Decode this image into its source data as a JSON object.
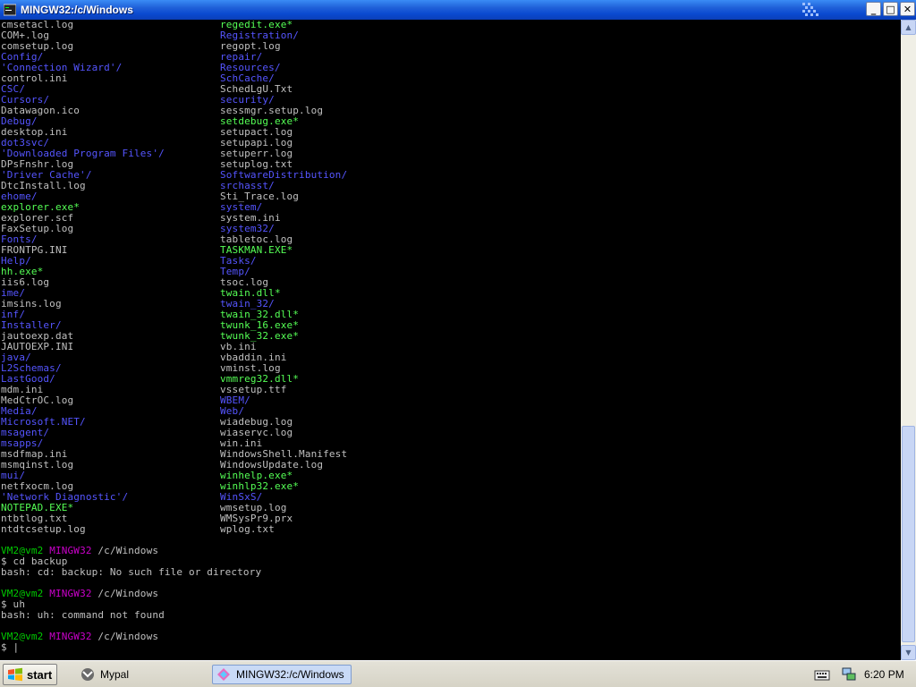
{
  "window": {
    "title": "MINGW32:/c/Windows",
    "buttons": {
      "minimize": "_",
      "maximize": "□",
      "close": "✕"
    }
  },
  "terminal": {
    "listing": [
      [
        {
          "t": "cmsetacl.log",
          "k": "file"
        },
        {
          "t": "regedit.exe*",
          "k": "exe"
        }
      ],
      [
        {
          "t": "COM+.log",
          "k": "file"
        },
        {
          "t": "Registration/",
          "k": "dir"
        }
      ],
      [
        {
          "t": "comsetup.log",
          "k": "file"
        },
        {
          "t": "regopt.log",
          "k": "file"
        }
      ],
      [
        {
          "t": "Config/",
          "k": "dir"
        },
        {
          "t": "repair/",
          "k": "dir"
        }
      ],
      [
        {
          "t": "'Connection Wizard'/",
          "k": "dir"
        },
        {
          "t": "Resources/",
          "k": "dir"
        }
      ],
      [
        {
          "t": "control.ini",
          "k": "file"
        },
        {
          "t": "SchCache/",
          "k": "dir"
        }
      ],
      [
        {
          "t": "CSC/",
          "k": "dir"
        },
        {
          "t": "SchedLgU.Txt",
          "k": "file"
        }
      ],
      [
        {
          "t": "Cursors/",
          "k": "dir"
        },
        {
          "t": "security/",
          "k": "dir"
        }
      ],
      [
        {
          "t": "Datawagon.ico",
          "k": "file"
        },
        {
          "t": "sessmgr.setup.log",
          "k": "file"
        }
      ],
      [
        {
          "t": "Debug/",
          "k": "dir"
        },
        {
          "t": "setdebug.exe*",
          "k": "exe"
        }
      ],
      [
        {
          "t": "desktop.ini",
          "k": "file"
        },
        {
          "t": "setupact.log",
          "k": "file"
        }
      ],
      [
        {
          "t": "dot3svc/",
          "k": "dir"
        },
        {
          "t": "setupapi.log",
          "k": "file"
        }
      ],
      [
        {
          "t": "'Downloaded Program Files'/",
          "k": "dir"
        },
        {
          "t": "setuperr.log",
          "k": "file"
        }
      ],
      [
        {
          "t": "DPsFnshr.log",
          "k": "file"
        },
        {
          "t": "setuplog.txt",
          "k": "file"
        }
      ],
      [
        {
          "t": "'Driver Cache'/",
          "k": "dir"
        },
        {
          "t": "SoftwareDistribution/",
          "k": "dir"
        }
      ],
      [
        {
          "t": "DtcInstall.log",
          "k": "file"
        },
        {
          "t": "srchasst/",
          "k": "dir"
        }
      ],
      [
        {
          "t": "ehome/",
          "k": "dir"
        },
        {
          "t": "Sti_Trace.log",
          "k": "file"
        }
      ],
      [
        {
          "t": "explorer.exe*",
          "k": "exe"
        },
        {
          "t": "system/",
          "k": "dir"
        }
      ],
      [
        {
          "t": "explorer.scf",
          "k": "file"
        },
        {
          "t": "system.ini",
          "k": "file"
        }
      ],
      [
        {
          "t": "FaxSetup.log",
          "k": "file"
        },
        {
          "t": "system32/",
          "k": "dir"
        }
      ],
      [
        {
          "t": "Fonts/",
          "k": "dir"
        },
        {
          "t": "tabletoc.log",
          "k": "file"
        }
      ],
      [
        {
          "t": "FRONTPG.INI",
          "k": "file"
        },
        {
          "t": "TASKMAN.EXE*",
          "k": "exe"
        }
      ],
      [
        {
          "t": "Help/",
          "k": "dir"
        },
        {
          "t": "Tasks/",
          "k": "dir"
        }
      ],
      [
        {
          "t": "hh.exe*",
          "k": "exe"
        },
        {
          "t": "Temp/",
          "k": "dir"
        }
      ],
      [
        {
          "t": "iis6.log",
          "k": "file"
        },
        {
          "t": "tsoc.log",
          "k": "file"
        }
      ],
      [
        {
          "t": "ime/",
          "k": "dir"
        },
        {
          "t": "twain.dll*",
          "k": "exe"
        }
      ],
      [
        {
          "t": "imsins.log",
          "k": "file"
        },
        {
          "t": "twain_32/",
          "k": "dir"
        }
      ],
      [
        {
          "t": "inf/",
          "k": "dir"
        },
        {
          "t": "twain_32.dll*",
          "k": "exe"
        }
      ],
      [
        {
          "t": "Installer/",
          "k": "dir"
        },
        {
          "t": "twunk_16.exe*",
          "k": "exe"
        }
      ],
      [
        {
          "t": "jautoexp.dat",
          "k": "file"
        },
        {
          "t": "twunk_32.exe*",
          "k": "exe"
        }
      ],
      [
        {
          "t": "JAUTOEXP.INI",
          "k": "file"
        },
        {
          "t": "vb.ini",
          "k": "file"
        }
      ],
      [
        {
          "t": "java/",
          "k": "dir"
        },
        {
          "t": "vbaddin.ini",
          "k": "file"
        }
      ],
      [
        {
          "t": "L2Schemas/",
          "k": "dir"
        },
        {
          "t": "vminst.log",
          "k": "file"
        }
      ],
      [
        {
          "t": "LastGood/",
          "k": "dir"
        },
        {
          "t": "vmmreg32.dll*",
          "k": "exe"
        }
      ],
      [
        {
          "t": "mdm.ini",
          "k": "file"
        },
        {
          "t": "vssetup.ttf",
          "k": "file"
        }
      ],
      [
        {
          "t": "MedCtrOC.log",
          "k": "file"
        },
        {
          "t": "WBEM/",
          "k": "dir"
        }
      ],
      [
        {
          "t": "Media/",
          "k": "dir"
        },
        {
          "t": "Web/",
          "k": "dir"
        }
      ],
      [
        {
          "t": "Microsoft.NET/",
          "k": "dir"
        },
        {
          "t": "wiadebug.log",
          "k": "file"
        }
      ],
      [
        {
          "t": "msagent/",
          "k": "dir"
        },
        {
          "t": "wiaservc.log",
          "k": "file"
        }
      ],
      [
        {
          "t": "msapps/",
          "k": "dir"
        },
        {
          "t": "win.ini",
          "k": "file"
        }
      ],
      [
        {
          "t": "msdfmap.ini",
          "k": "file"
        },
        {
          "t": "WindowsShell.Manifest",
          "k": "file"
        }
      ],
      [
        {
          "t": "msmqinst.log",
          "k": "file"
        },
        {
          "t": "WindowsUpdate.log",
          "k": "file"
        }
      ],
      [
        {
          "t": "mui/",
          "k": "dir"
        },
        {
          "t": "winhelp.exe*",
          "k": "exe"
        }
      ],
      [
        {
          "t": "netfxocm.log",
          "k": "file"
        },
        {
          "t": "winhlp32.exe*",
          "k": "exe"
        }
      ],
      [
        {
          "t": "'Network Diagnostic'/",
          "k": "dir"
        },
        {
          "t": "WinSxS/",
          "k": "dir"
        }
      ],
      [
        {
          "t": "NOTEPAD.EXE*",
          "k": "exe"
        },
        {
          "t": "wmsetup.log",
          "k": "file"
        }
      ],
      [
        {
          "t": "ntbtlog.txt",
          "k": "file"
        },
        {
          "t": "WMSysPr9.prx",
          "k": "file"
        }
      ],
      [
        {
          "t": "ntdtcsetup.log",
          "k": "file"
        },
        {
          "t": "wplog.txt",
          "k": "file"
        }
      ]
    ],
    "session": [
      {
        "user": "VM2@vm2",
        "host": "MINGW32",
        "path": " /c/Windows",
        "cmd": "$ cd backup",
        "out": "bash: cd: backup: No such file or directory"
      },
      {
        "user": "VM2@vm2",
        "host": "MINGW32",
        "path": " /c/Windows",
        "cmd": "$ uh",
        "out": "bash: uh: command not found"
      },
      {
        "user": "VM2@vm2",
        "host": "MINGW32",
        "path": " /c/Windows",
        "cmd": "$ |",
        "out": ""
      }
    ]
  },
  "taskbar": {
    "start_label": "start",
    "tasks": [
      {
        "label": "Mypal",
        "icon": "mypal-icon"
      },
      {
        "label": "MINGW32:/c/Windows",
        "icon": "mingw-icon"
      }
    ],
    "clock": "6:20 PM"
  },
  "colors": {
    "file": "#c0c0c0",
    "dir": "#5555ff",
    "exe": "#55ff55",
    "prompt_user": "#00cc00",
    "prompt_host": "#cc00cc"
  }
}
